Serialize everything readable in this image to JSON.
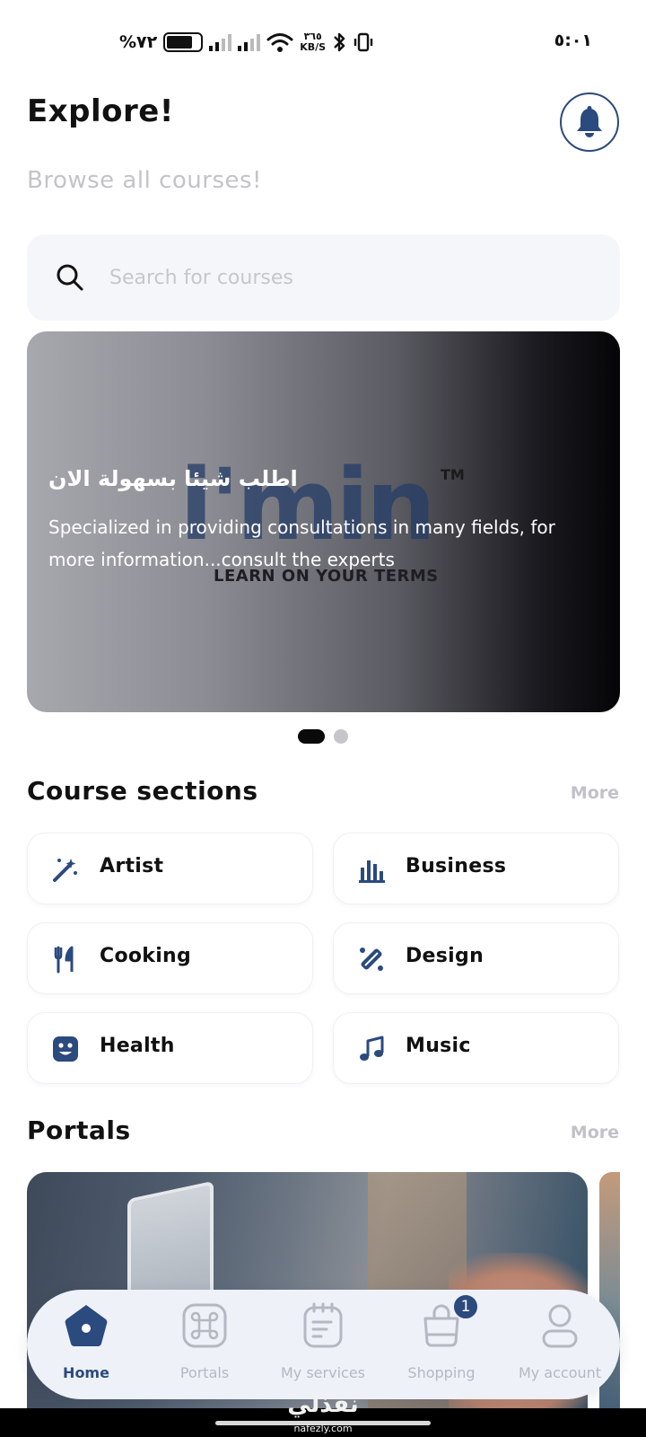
{
  "status_bar": {
    "battery_percent": "%٧٢",
    "battery_level": 0.72,
    "net_speed_value": "٣٦٥",
    "net_speed_unit": "KB/S",
    "time": "٥:٠١"
  },
  "header": {
    "title": "Explore!",
    "subtitle": "Browse all courses!",
    "bell_icon": "bell-icon"
  },
  "search": {
    "placeholder": "Search for courses",
    "value": "",
    "icon": "search-icon"
  },
  "banner": {
    "logo_text": "i'min",
    "logo_tm": "TM",
    "logo_tagline": "LEARN ON YOUR TERMS",
    "heading": "اطلب شيئا بسهولة الان",
    "text": "Specialized in providing consultations in many fields, for more information...consult the experts",
    "slides_total": 2,
    "active_slide": 1
  },
  "course_sections": {
    "title": "Course sections",
    "more_label": "More",
    "items": [
      {
        "label": "Artist",
        "icon": "magic-wand-icon"
      },
      {
        "label": "Business",
        "icon": "bar-chart-icon"
      },
      {
        "label": "Cooking",
        "icon": "fork-knife-icon"
      },
      {
        "label": "Design",
        "icon": "design-tools-icon"
      },
      {
        "label": "Health",
        "icon": "smiley-face-icon"
      },
      {
        "label": "Music",
        "icon": "music-note-icon"
      }
    ]
  },
  "portals": {
    "title": "Portals",
    "more_label": "More"
  },
  "bottom_nav": {
    "items": [
      {
        "label": "Home",
        "icon": "home-icon",
        "active": true
      },
      {
        "label": "Portals",
        "icon": "command-icon",
        "active": false
      },
      {
        "label": "My services",
        "icon": "notepad-icon",
        "active": false
      },
      {
        "label": "Shopping",
        "icon": "shopping-bag-icon",
        "active": false,
        "badge": "1"
      },
      {
        "label": "My account",
        "icon": "user-icon",
        "active": false
      }
    ]
  },
  "watermark": {
    "text": "نفذلي",
    "sub": "nafezly.com"
  },
  "colors": {
    "accent": "#2b4a7e",
    "muted_text": "#c3c4c8",
    "search_bg": "#f5f6f9",
    "nav_bg": "#eef1f8"
  }
}
